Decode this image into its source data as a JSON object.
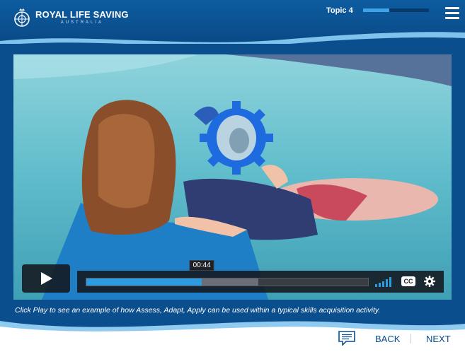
{
  "brand": {
    "title": "ROYAL LIFE SAVING",
    "subtitle": "AUSTRALIA",
    "logo_icon": "rls-crest-icon"
  },
  "header": {
    "topic_label": "Topic 4",
    "topic_progress": 0.4,
    "menu_icon": "hamburger-menu-icon"
  },
  "video": {
    "current_time": "00:44",
    "played_fraction": 0.41,
    "buffered_fraction": 0.61,
    "play_icon": "play-icon",
    "cc_label": "CC",
    "volume_icon": "volume-bars-icon",
    "settings_icon": "gear-icon"
  },
  "caption": "Click Play to see an example of how Assess, Adapt, Apply can be used within a typical skills acquisition activity.",
  "footer": {
    "transcript_icon": "transcript-icon",
    "back_label": "BACK",
    "next_label": "NEXT"
  },
  "colors": {
    "brand_blue": "#0a4c8c",
    "accent_blue": "#2e9be0",
    "wave_light": "#cfe6f7"
  }
}
